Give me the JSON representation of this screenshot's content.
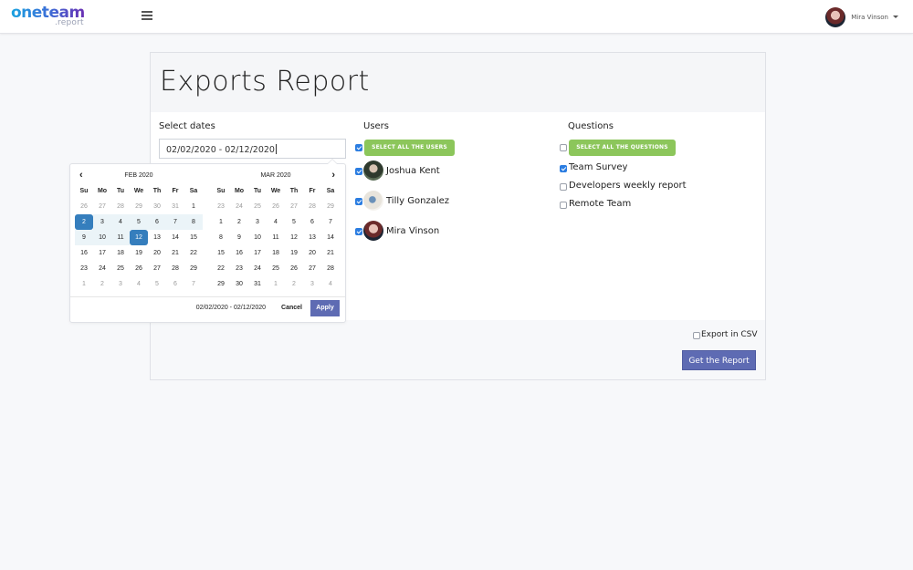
{
  "header": {
    "logo_main": "oneteam",
    "logo_sub": ".report",
    "menu_icon": "hamburger-icon",
    "user_name": "Mira Vinson"
  },
  "page": {
    "title": "Exports Report"
  },
  "dates": {
    "label": "Select dates",
    "value": "02/02/2020 - 02/12/2020"
  },
  "users": {
    "label": "Users",
    "select_all_label": "SELECT ALL THE USERS",
    "select_all_checked": true,
    "items": [
      {
        "name": "Joshua Kent",
        "checked": true
      },
      {
        "name": "Tilly Gonzalez",
        "checked": true
      },
      {
        "name": "Mira Vinson",
        "checked": true
      }
    ]
  },
  "questions": {
    "label": "Questions",
    "select_all_label": "SELECT ALL THE QUESTIONS",
    "select_all_checked": false,
    "items": [
      {
        "name": "Team Survey",
        "checked": true
      },
      {
        "name": "Developers weekly report",
        "checked": false
      },
      {
        "name": "Remote Team",
        "checked": false
      }
    ]
  },
  "export": {
    "csv_label": "Export in CSV",
    "csv_checked": false,
    "submit_label": "Get the Report"
  },
  "datepicker": {
    "weekdays": [
      "Su",
      "Mo",
      "Tu",
      "We",
      "Th",
      "Fr",
      "Sa"
    ],
    "left": {
      "title": "FEB 2020",
      "days": [
        {
          "d": "26",
          "off": true
        },
        {
          "d": "27",
          "off": true
        },
        {
          "d": "28",
          "off": true
        },
        {
          "d": "29",
          "off": true
        },
        {
          "d": "30",
          "off": true
        },
        {
          "d": "31",
          "off": true
        },
        {
          "d": "1"
        },
        {
          "d": "2",
          "sel": true
        },
        {
          "d": "3",
          "range": true
        },
        {
          "d": "4",
          "range": true
        },
        {
          "d": "5",
          "range": true
        },
        {
          "d": "6",
          "range": true
        },
        {
          "d": "7",
          "range": true
        },
        {
          "d": "8",
          "range": true
        },
        {
          "d": "9",
          "range": true
        },
        {
          "d": "10",
          "range": true
        },
        {
          "d": "11",
          "range": true
        },
        {
          "d": "12",
          "sel": true
        },
        {
          "d": "13"
        },
        {
          "d": "14"
        },
        {
          "d": "15"
        },
        {
          "d": "16"
        },
        {
          "d": "17"
        },
        {
          "d": "18"
        },
        {
          "d": "19"
        },
        {
          "d": "20"
        },
        {
          "d": "21"
        },
        {
          "d": "22"
        },
        {
          "d": "23"
        },
        {
          "d": "24"
        },
        {
          "d": "25"
        },
        {
          "d": "26"
        },
        {
          "d": "27"
        },
        {
          "d": "28"
        },
        {
          "d": "29"
        },
        {
          "d": "1",
          "off": true
        },
        {
          "d": "2",
          "off": true
        },
        {
          "d": "3",
          "off": true
        },
        {
          "d": "4",
          "off": true
        },
        {
          "d": "5",
          "off": true
        },
        {
          "d": "6",
          "off": true
        },
        {
          "d": "7",
          "off": true
        }
      ]
    },
    "right": {
      "title": "MAR 2020",
      "days": [
        {
          "d": "23",
          "off": true
        },
        {
          "d": "24",
          "off": true
        },
        {
          "d": "25",
          "off": true
        },
        {
          "d": "26",
          "off": true
        },
        {
          "d": "27",
          "off": true
        },
        {
          "d": "28",
          "off": true
        },
        {
          "d": "29",
          "off": true
        },
        {
          "d": "1"
        },
        {
          "d": "2"
        },
        {
          "d": "3"
        },
        {
          "d": "4"
        },
        {
          "d": "5"
        },
        {
          "d": "6"
        },
        {
          "d": "7"
        },
        {
          "d": "8"
        },
        {
          "d": "9"
        },
        {
          "d": "10"
        },
        {
          "d": "11"
        },
        {
          "d": "12"
        },
        {
          "d": "13"
        },
        {
          "d": "14"
        },
        {
          "d": "15"
        },
        {
          "d": "16"
        },
        {
          "d": "17"
        },
        {
          "d": "18"
        },
        {
          "d": "19"
        },
        {
          "d": "20"
        },
        {
          "d": "21"
        },
        {
          "d": "22"
        },
        {
          "d": "23"
        },
        {
          "d": "24"
        },
        {
          "d": "25"
        },
        {
          "d": "26"
        },
        {
          "d": "27"
        },
        {
          "d": "28"
        },
        {
          "d": "29"
        },
        {
          "d": "30"
        },
        {
          "d": "31"
        },
        {
          "d": "1",
          "off": true
        },
        {
          "d": "2",
          "off": true
        },
        {
          "d": "3",
          "off": true
        },
        {
          "d": "4",
          "off": true
        }
      ]
    },
    "range_text": "02/02/2020 - 02/12/2020",
    "cancel_label": "Cancel",
    "apply_label": "Apply"
  }
}
